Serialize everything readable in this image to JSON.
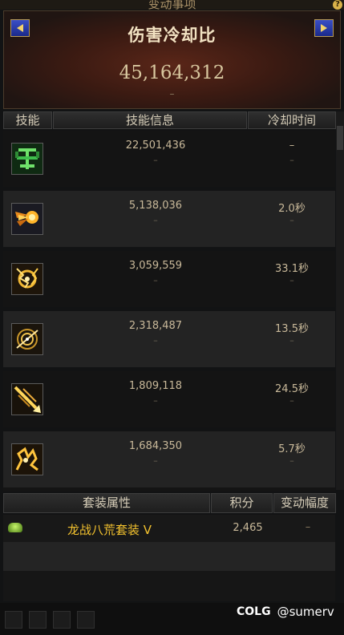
{
  "top_title": "变动事项",
  "header": {
    "title": "伤害冷却比",
    "value": "45,164,312",
    "sub": "–"
  },
  "columns": {
    "skill": "技能",
    "info": "技能信息",
    "cooldown": "冷却时间"
  },
  "skills": [
    {
      "icon": "green-rune-icon",
      "damage": "22,501,436",
      "damage_sub": "–",
      "cooldown": "–",
      "cooldown_sub": "–"
    },
    {
      "icon": "fireball-icon",
      "damage": "5,138,036",
      "damage_sub": "–",
      "cooldown": "2.0秒",
      "cooldown_sub": "–"
    },
    {
      "icon": "lightning-orb-icon",
      "damage": "3,059,559",
      "damage_sub": "–",
      "cooldown": "33.1秒",
      "cooldown_sub": "–"
    },
    {
      "icon": "vortex-icon",
      "damage": "2,318,487",
      "damage_sub": "–",
      "cooldown": "13.5秒",
      "cooldown_sub": "–"
    },
    {
      "icon": "spear-strike-icon",
      "damage": "1,809,118",
      "damage_sub": "–",
      "cooldown": "24.5秒",
      "cooldown_sub": "–"
    },
    {
      "icon": "flame-dance-icon",
      "damage": "1,684,350",
      "damage_sub": "–",
      "cooldown": "5.7秒",
      "cooldown_sub": "–"
    }
  ],
  "set_table": {
    "headers": {
      "attr": "套装属性",
      "score": "积分",
      "delta": "变动幅度"
    },
    "rows": [
      {
        "icon": "helmet-icon",
        "name": "龙战八荒套装 V",
        "score": "2,465",
        "delta": "–"
      }
    ]
  },
  "watermark": {
    "logo": "COLG",
    "user": "@sumerv"
  },
  "colors": {
    "accent_gold": "#f2c12e",
    "header_red": "#3a1a12",
    "button_blue": "#2b3fb8"
  }
}
